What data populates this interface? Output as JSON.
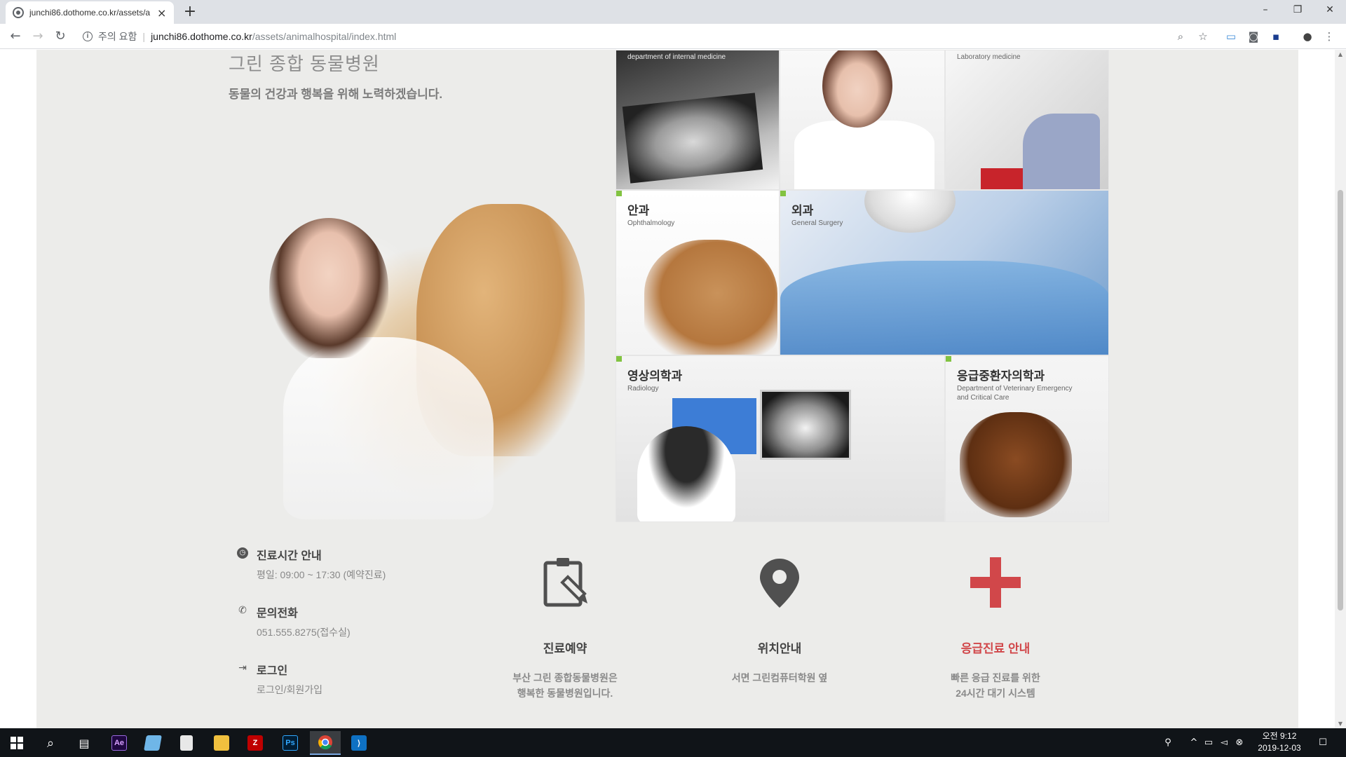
{
  "browser": {
    "tab_title": "junchi86.dothome.co.kr/assets/a",
    "new_tab": "+",
    "url_warning": "주의 요함",
    "url_separator": "|",
    "url_host": "junchi86.dothome.co.kr",
    "url_path": "/assets/animalhospital/index.html",
    "window_controls": [
      "–",
      "❐",
      "✕"
    ]
  },
  "hero": {
    "title": "그린 종합 동물병원",
    "subtitle": "동물의 건강과 행복을 위해 노력하겠습니다."
  },
  "departments": {
    "internal_en": "department of internal medicine",
    "lab_en": "Laboratory medicine",
    "ophthalmology": {
      "ko": "안과",
      "en": "Ophthalmology"
    },
    "surgery": {
      "ko": "외과",
      "en": "General Surgery"
    },
    "radiology": {
      "ko": "영상의학과",
      "en": "Radiology"
    },
    "emergency": {
      "ko": "응급중환자의학과",
      "en": "Department of Veterinary Emergency and Critical Care"
    }
  },
  "info": [
    {
      "icon": "clock-icon",
      "label": "진료시간 안내",
      "value": "평일: 09:00 ~ 17:30 (예약진료)"
    },
    {
      "icon": "phone-icon",
      "label": "문의전화",
      "value": "051.555.8275(접수실)"
    },
    {
      "icon": "login-icon",
      "label": "로그인",
      "value": "로그인/회원가입"
    }
  ],
  "features": [
    {
      "icon": "clipboard-icon",
      "title": "진료예약",
      "desc1": "부산 그린 종합동물병원은",
      "desc2": "행복한 동물병원입니다."
    },
    {
      "icon": "location-pin-icon",
      "title": "위치안내",
      "desc1": "서면 그린컴퓨터학원 옆",
      "desc2": ""
    },
    {
      "icon": "medical-cross-icon",
      "title": "응급진료 안내",
      "desc1": "빠른 응급 진료를 위한",
      "desc2": "24시간 대기 시스템"
    }
  ],
  "colors": {
    "accent_red": "#d1474a",
    "dept_marker_green": "#82c341",
    "page_background": "#ececea"
  },
  "taskbar": {
    "apps": [
      "start-icon",
      "search-icon",
      "task-view-icon",
      "after-effects-icon",
      "notepad-icon",
      "calculator-icon",
      "file-explorer-icon",
      "filezilla-icon",
      "photoshop-icon",
      "chrome-icon",
      "vscode-icon"
    ],
    "ae_label": "Ae",
    "ps_label": "Ps",
    "time": "오전 9:12",
    "date": "2019-12-03"
  }
}
